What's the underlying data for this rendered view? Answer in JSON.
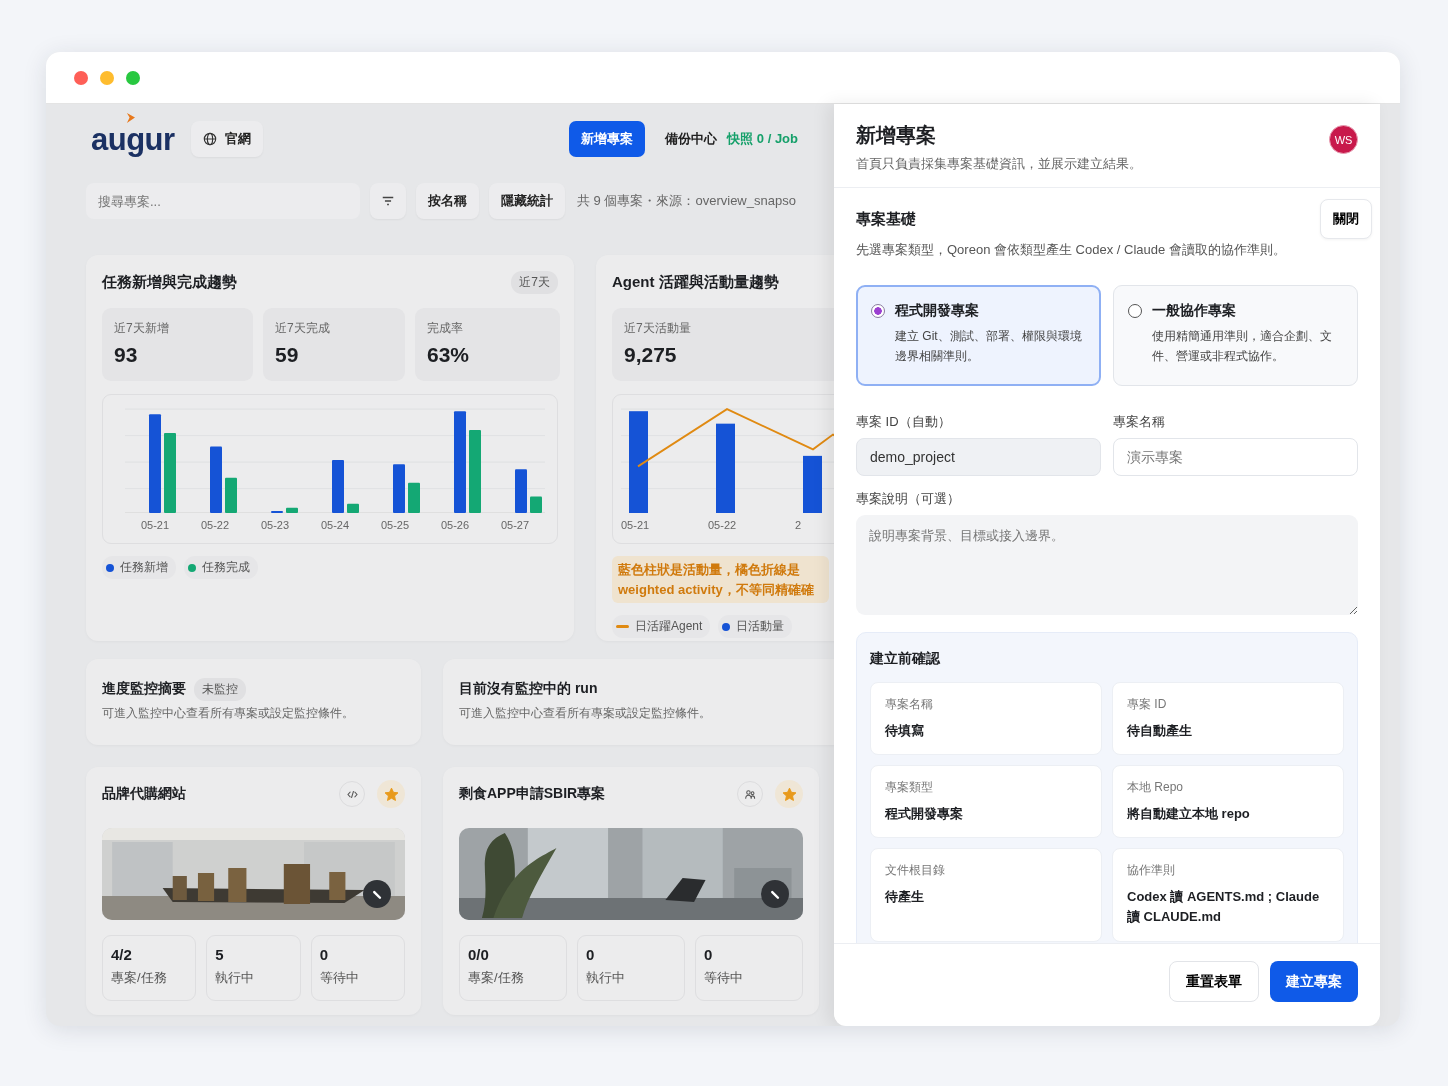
{
  "header": {
    "logo": "augur",
    "website_button": "官網",
    "new_project_button": "新增專案",
    "backup_center_link": "備份中心",
    "snapshot_status": "快照 0 / Job"
  },
  "toolbar": {
    "search": {
      "placeholder": "搜尋專案..."
    },
    "sort_button": "按名稱",
    "hide_stats_button": "隱藏統計",
    "summary": "共 9 個專案・來源：overview_snapso"
  },
  "task_trend": {
    "title": "任務新增與完成趨勢",
    "range_badge": "近7天",
    "stats": [
      {
        "label": "近7天新增",
        "value": "93"
      },
      {
        "label": "近7天完成",
        "value": "59"
      },
      {
        "label": "完成率",
        "value": "63%"
      }
    ],
    "x_labels": [
      "05-21",
      "05-22",
      "05-23",
      "05-24",
      "05-25",
      "05-26",
      "05-27"
    ],
    "legend": [
      {
        "label": "任務新增",
        "color": "#1553d6"
      },
      {
        "label": "任務完成",
        "color": "#14a874"
      }
    ]
  },
  "agent_trend": {
    "title": "Agent 活躍與活動量趨勢",
    "stats": [
      {
        "label": "近7天活動量",
        "value": "9,275"
      }
    ],
    "x_labels": [
      "05-21",
      "05-22",
      "2"
    ],
    "note": "藍色柱狀是活動量，橘色折線是weighted activity，不等同精確確",
    "legend": [
      {
        "label": "日活躍Agent",
        "color": "#e08a12",
        "kind": "line"
      },
      {
        "label": "日活動量",
        "color": "#1553d6",
        "kind": "dot"
      }
    ]
  },
  "monitor": {
    "title": "進度監控摘要",
    "status_badge": "未監控",
    "description": "可進入監控中心查看所有專案或設定監控條件。"
  },
  "run_monitor": {
    "title": "目前沒有監控中的 run",
    "description": "可進入監控中心查看所有專案或設定監控條件。"
  },
  "projects": [
    {
      "name": "品牌代購網站",
      "favorite": true,
      "stats": [
        {
          "value": "4/2",
          "label": "專案/任務"
        },
        {
          "value": "5",
          "label": "執行中"
        },
        {
          "value": "0",
          "label": "等待中"
        }
      ]
    },
    {
      "name": "剩食APP申請SBIR專案",
      "favorite": true,
      "stats": [
        {
          "value": "0/0",
          "label": "專案/任務"
        },
        {
          "value": "0",
          "label": "執行中"
        },
        {
          "value": "0",
          "label": "等待中"
        }
      ]
    }
  ],
  "drawer": {
    "title": "新增專案",
    "subtitle": "首頁只負責採集專案基礎資訊，並展示建立結果。",
    "avatar": "WS",
    "section_title": "專案基礎",
    "close_button": "關閉",
    "section_hint": "先選專案類型，Qoreon 會依類型產生 Codex / Claude 會讀取的協作準則。",
    "project_types": [
      {
        "title": "程式開發專案",
        "description": "建立 Git、測試、部署、權限與環境邊界相關準則。",
        "selected": true
      },
      {
        "title": "一般協作專案",
        "description": "使用精簡通用準則，適合企劃、文件、營運或非程式協作。",
        "selected": false
      }
    ],
    "id_field": {
      "label": "專案 ID（自動）",
      "value": "demo_project"
    },
    "name_field": {
      "label": "專案名稱",
      "placeholder": "演示專案"
    },
    "description_field": {
      "label": "專案說明（可選）",
      "placeholder": "說明專案背景、目標或接入邊界。"
    },
    "confirmation": {
      "title": "建立前確認",
      "items": [
        {
          "label": "專案名稱",
          "value": "待填寫"
        },
        {
          "label": "專案 ID",
          "value": "待自動產生"
        },
        {
          "label": "專案類型",
          "value": "程式開發專案"
        },
        {
          "label": "本地 Repo",
          "value": "將自動建立本地 repo"
        },
        {
          "label": "文件根目錄",
          "value": "待產生"
        },
        {
          "label": "協作準則",
          "value": "Codex 讀 AGENTS.md ; Claude 讀 CLAUDE.md"
        }
      ]
    },
    "reset_button": "重置表單",
    "create_button": "建立專案"
  }
}
